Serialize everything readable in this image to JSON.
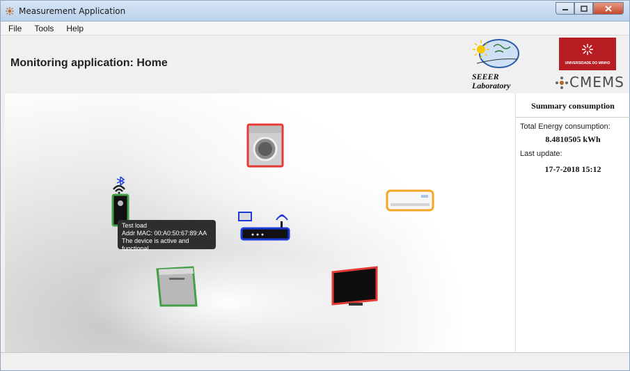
{
  "window": {
    "title": "Measurement Application"
  },
  "menu": {
    "items": [
      "File",
      "Tools",
      "Help"
    ]
  },
  "header": {
    "title": "Monitoring application: Home",
    "seeer_lab_line1": "SEEER",
    "seeer_lab_line2": "Laboratory",
    "uminho_label": "UNIVERSIDADE DO MINHO",
    "cmems_label": "CMEMS"
  },
  "summary": {
    "title": "Summary consumption",
    "energy_label": "Total Energy consumption:",
    "energy_value": "8.4810505 kWh",
    "update_label": "Last update:",
    "update_value": "17-7-2018 15:12"
  },
  "tooltip": {
    "line1": "Test load",
    "line2": "Addr MAC: 00:A0:50:67:89:AA",
    "line3": "The device is active and functional"
  },
  "devices": [
    {
      "name": "washing-machine",
      "status_color": "#e53935"
    },
    {
      "name": "air-conditioner",
      "status_color": "#f5a623"
    },
    {
      "name": "test-load",
      "status_color": "#43a047"
    },
    {
      "name": "router",
      "status_color": "#1e3adb"
    },
    {
      "name": "dishwasher",
      "status_color": "#43a047"
    },
    {
      "name": "television",
      "status_color": "#e53935"
    }
  ],
  "icons": [
    "app-icon",
    "minimize-icon",
    "maximize-icon",
    "close-icon",
    "sun-icon",
    "bluetooth-icon",
    "wifi-icon"
  ]
}
